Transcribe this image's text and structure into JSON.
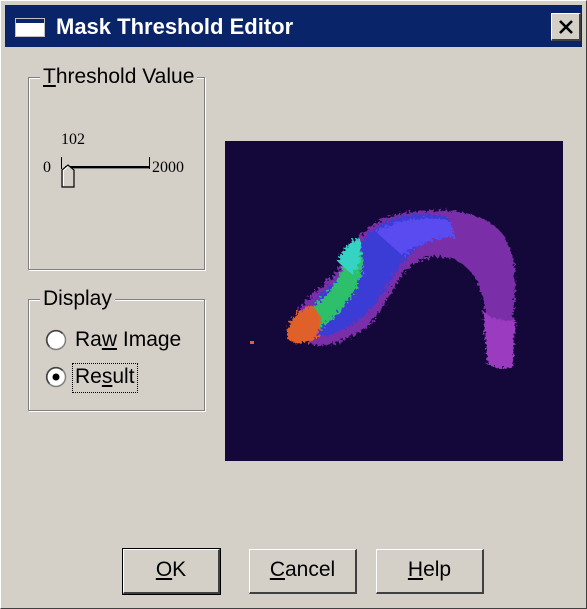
{
  "window": {
    "title": "Mask Threshold Editor"
  },
  "threshold": {
    "legend_first": "T",
    "legend_rest": "hreshold Value",
    "current_value": "102",
    "min_label": "0",
    "max_label": "2000",
    "min": 0,
    "max": 2000,
    "value": 102
  },
  "display": {
    "legend": "Display",
    "options": [
      {
        "pre": "Ra",
        "accel": "w",
        "post": " Image",
        "selected": false
      },
      {
        "pre": "Re",
        "accel": "s",
        "post": "ult",
        "selected": true
      }
    ]
  },
  "buttons": {
    "ok": {
      "accel": "O",
      "rest": "K"
    },
    "cancel": {
      "accel": "C",
      "rest": "ancel"
    },
    "help": {
      "accel": "H",
      "rest": "elp"
    }
  },
  "colors": {
    "title_bar": "#0a246a",
    "face": "#d4d0c8",
    "image_background": "#14083b"
  }
}
